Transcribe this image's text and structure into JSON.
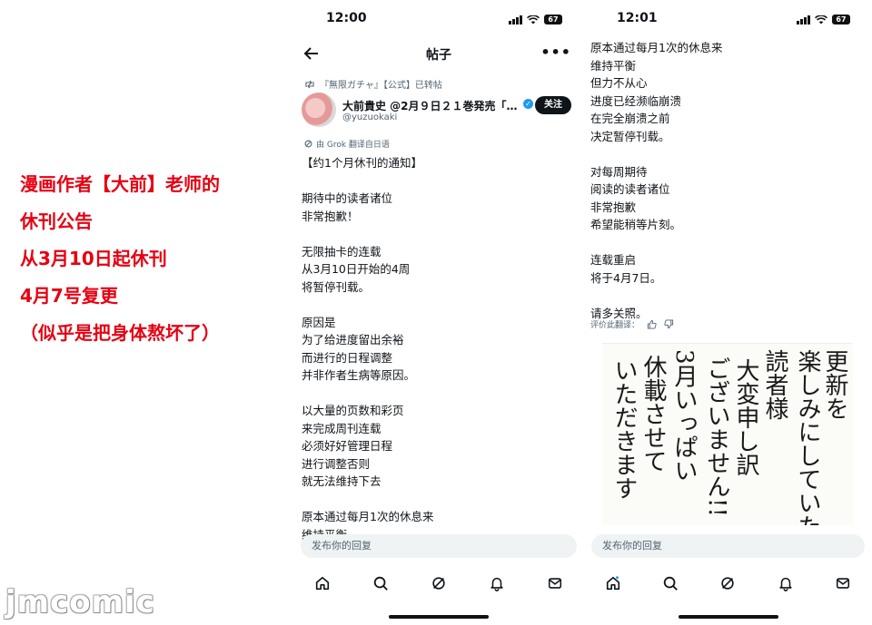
{
  "caption": {
    "lines": [
      "漫画作者【大前】老师的",
      "休刊公告",
      "从3月10日起休刊",
      "4月7号复更",
      "（似乎是把身体熬坏了）"
    ],
    "color": "#e60012"
  },
  "watermark": "jmcomic",
  "phone1": {
    "time": "12:00",
    "battery": "67",
    "title": "帖子",
    "repost_label": "『無限ガチャ』【公式】已转帖",
    "author_name": "大前貴史 @2月９日２１巻発売「…",
    "handle": "@yuzuokaki",
    "follow_label": "关注",
    "translate_note": "由 Grok 翻译自日语",
    "post_lines": [
      "【约1个月休刊的通知】",
      "",
      "期待中的读者诸位",
      "非常抱歉！",
      "",
      "无限抽卡的连载",
      "从3月10日开始的4周",
      "将暂停刊载。",
      "",
      "原因是",
      "为了给进度留出余裕",
      "而进行的日程调整",
      "并非作者生病等原因。",
      "",
      "以大量的页数和彩页",
      "来完成周刊连载",
      "必须好好管理日程",
      "进行调整否则",
      "就无法维持下去",
      "",
      "原本通过每月1次的休息来",
      "维持平衡"
    ],
    "reply_placeholder": "发布你的回复"
  },
  "phone2": {
    "time": "12:01",
    "battery": "67",
    "post_lines": [
      "原本通过每月1次的休息来",
      "维持平衡",
      "但力不从心",
      "进度已经濒临崩溃",
      "在完全崩溃之前",
      "决定暂停刊载。",
      "",
      "对每周期待",
      "阅读的读者诸位",
      "非常抱歉",
      "希望能稍等片刻。",
      "",
      "连载重启",
      "将于4月7日。",
      "",
      "请多关照。"
    ],
    "rate_label": "评价此翻译：",
    "handwritten_columns": [
      "更新を",
      "楽しみにしていただ",
      "読者様",
      "大変申し訳",
      "ございません!!",
      "3月いっぱい",
      "休載させて",
      "いただきます"
    ],
    "reply_placeholder": "发布你的回复"
  },
  "nav_icons": [
    "home-icon",
    "search-icon",
    "grok-icon",
    "notifications-icon",
    "messages-icon"
  ]
}
